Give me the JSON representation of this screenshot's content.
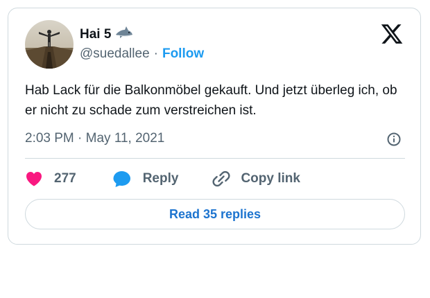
{
  "author": {
    "display_name": "Hai 5",
    "name_emoji_icon": "shark-icon",
    "handle": "@suedallee",
    "separator": "·",
    "follow_label": "Follow"
  },
  "brand_icon": "x-logo-icon",
  "tweet": {
    "text": "Hab Lack für die Balkonmöbel gekauft. Und jetzt überleg ich, ob er nicht zu schade zum verstreichen ist.",
    "timestamp": "2:03 PM · May 11, 2021"
  },
  "actions": {
    "like_count": "277",
    "reply_label": "Reply",
    "copy_link_label": "Copy link"
  },
  "read_replies_label": "Read 35 replies",
  "colors": {
    "like": "#f91880",
    "reply": "#1d9bf0",
    "follow": "#1d9bf0",
    "read_replies": "#1d74cf"
  }
}
